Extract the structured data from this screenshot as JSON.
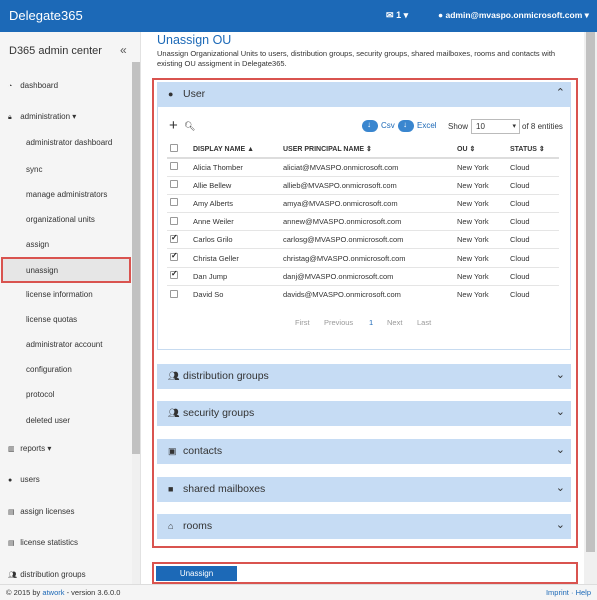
{
  "topbar": {
    "brand": "Delegate365",
    "mail_icon": "envelope-icon",
    "mail_count": "1",
    "user_icon": "user-icon",
    "user_email": "admin@mvaspo.onmicrosoft.com"
  },
  "sidebar": {
    "title": "D365 admin center",
    "collapse": "«",
    "items": [
      {
        "label": "dashboard",
        "icon": "dashboard-icon"
      },
      {
        "label": "administration",
        "icon": "lock-icon"
      },
      {
        "label": "reports",
        "icon": "bar-chart-icon"
      },
      {
        "label": "users",
        "icon": "user-icon"
      },
      {
        "label": "assign licenses",
        "icon": "file-icon"
      },
      {
        "label": "license statistics",
        "icon": "file-icon"
      },
      {
        "label": "distribution groups",
        "icon": "users-icon"
      }
    ],
    "sub_items": [
      "administrator dashboard",
      "sync",
      "manage administrators",
      "organizational units",
      "assign",
      "unassign",
      "license information",
      "license quotas",
      "administrator account",
      "configuration",
      "protocol",
      "deleted user"
    ]
  },
  "main": {
    "title": "Unassign OU",
    "description": "Unassign Organizational Units to users, distribution groups, security groups, shared mailboxes, rooms and contacts with existing OU assigment in Delegate365.",
    "user_panel": {
      "label": "User",
      "export_csv": "Csv",
      "export_excel": "Excel",
      "show_label": "Show",
      "page_size": "10",
      "entries_label": "of 8 entities",
      "columns": [
        "DISPLAY NAME",
        "USER PRINCIPAL NAME",
        "OU",
        "STATUS"
      ],
      "rows": [
        {
          "checked": false,
          "name": "Alicia Thomber",
          "upn": "aliciat@MVASPO.onmicrosoft.com",
          "ou": "New York",
          "status": "Cloud"
        },
        {
          "checked": false,
          "name": "Allie Bellew",
          "upn": "allieb@MVASPO.onmicrosoft.com",
          "ou": "New York",
          "status": "Cloud"
        },
        {
          "checked": false,
          "name": "Amy Alberts",
          "upn": "amya@MVASPO.onmicrosoft.com",
          "ou": "New York",
          "status": "Cloud"
        },
        {
          "checked": false,
          "name": "Anne Weiler",
          "upn": "annew@MVASPO.onmicrosoft.com",
          "ou": "New York",
          "status": "Cloud"
        },
        {
          "checked": true,
          "name": "Carlos Grilo",
          "upn": "carlosg@MVASPO.onmicrosoft.com",
          "ou": "New York",
          "status": "Cloud"
        },
        {
          "checked": true,
          "name": "Christa Geller",
          "upn": "christag@MVASPO.onmicrosoft.com",
          "ou": "New York",
          "status": "Cloud"
        },
        {
          "checked": true,
          "name": "Dan Jump",
          "upn": "danj@MVASPO.onmicrosoft.com",
          "ou": "New York",
          "status": "Cloud"
        },
        {
          "checked": false,
          "name": "David So",
          "upn": "davids@MVASPO.onmicrosoft.com",
          "ou": "New York",
          "status": "Cloud"
        }
      ],
      "pager": {
        "first": "First",
        "previous": "Previous",
        "current": "1",
        "next": "Next",
        "last": "Last"
      }
    },
    "panels": [
      {
        "label": "distribution groups",
        "icon": "users-icon"
      },
      {
        "label": "security groups",
        "icon": "users-icon"
      },
      {
        "label": "contacts",
        "icon": "contact-card-icon"
      },
      {
        "label": "shared mailboxes",
        "icon": "inbox-icon"
      },
      {
        "label": "rooms",
        "icon": "home-icon"
      }
    ],
    "unassign_button": "Unassign"
  },
  "footer": {
    "copyright": "© 2015 by",
    "company": "atwork",
    "version": "- version 3.6.0.0",
    "imprint": "Imprint",
    "help": "Help"
  },
  "colors": {
    "brand": "#1c69b7",
    "panel_header": "#c6dcf4",
    "highlight_border": "#d9534f"
  }
}
